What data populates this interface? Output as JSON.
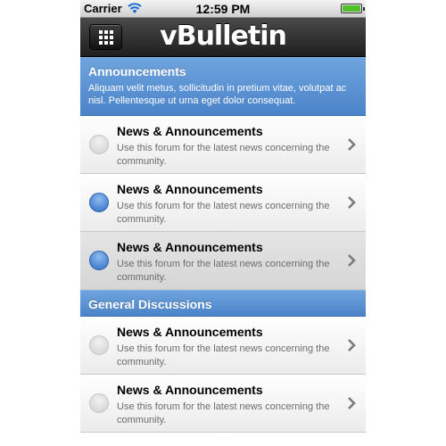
{
  "status_bar": {
    "carrier": "Carrier",
    "time": "12:59 PM",
    "battery_level": 1.0,
    "wifi_icon": "wifi-icon",
    "battery_icon": "battery-icon"
  },
  "header": {
    "logo_text": "vBulletin",
    "menu_icon": "grid-menu-icon"
  },
  "sections": [
    {
      "title": "Announcements",
      "description": "Aliquam velit metus, sollicitudin in pretium vitae, volutpat ac nisl. Pellentesque ut urna eget dolor consequat.",
      "forums": [
        {
          "title": "News & Announcements",
          "description": "Use this forum for the latest news concerning the community.",
          "status": "read"
        },
        {
          "title": "News & Announcements",
          "description": "Use this forum for the latest news concerning the community.",
          "status": "unread"
        },
        {
          "title": "News & Announcements",
          "description": "Use this forum for the latest news concerning the community.",
          "status": "unread"
        }
      ]
    },
    {
      "title": "General Discussions",
      "forums": [
        {
          "title": "News & Announcements",
          "description": "Use this forum for the latest news concerning the community.",
          "status": "read"
        },
        {
          "title": "News & Announcements",
          "description": "Use this forum for the latest news concerning the community.",
          "status": "read"
        }
      ]
    }
  ],
  "colors": {
    "section_header": "#5b92d6",
    "unread_indicator": "#3f7fd0",
    "read_indicator": "#dcdcdc"
  }
}
